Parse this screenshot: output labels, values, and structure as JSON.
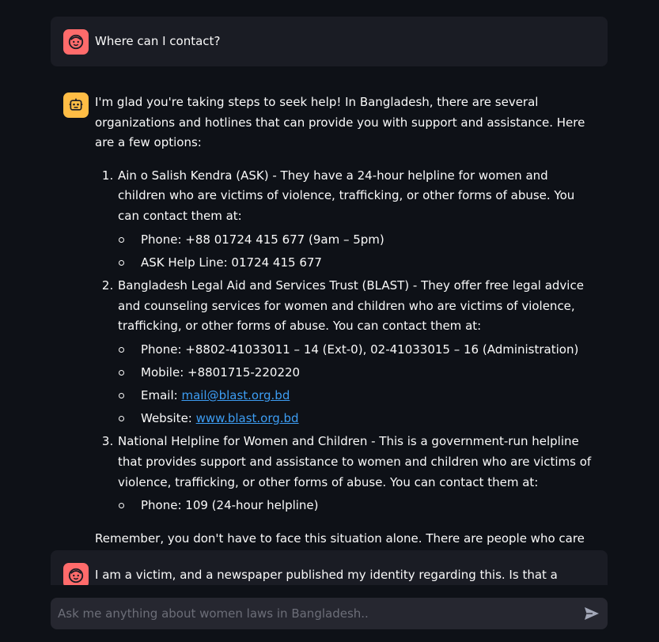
{
  "messages": [
    {
      "role": "user",
      "text": "Where can I contact?"
    },
    {
      "role": "assistant",
      "intro": "I'm glad you're taking steps to seek help! In Bangladesh, there are several organizations and hotlines that can provide you with support and assistance. Here are a few options:",
      "items": [
        {
          "text": "Ain o Salish Kendra (ASK) - They have a 24-hour helpline for women and children who are victims of violence, trafficking, or other forms of abuse. You can contact them at:",
          "contacts": [
            {
              "label": "Phone: +88 01724 415 677 (9am – 5pm)"
            },
            {
              "label": "ASK Help Line: 01724 415 677"
            }
          ]
        },
        {
          "text": "Bangladesh Legal Aid and Services Trust (BLAST) - They offer free legal advice and counseling services for women and children who are victims of violence, trafficking, or other forms of abuse. You can contact them at:",
          "contacts": [
            {
              "label": "Phone: +8802-41033011 – 14 (Ext-0), 02-41033015 – 16 (Administration)"
            },
            {
              "label": "Mobile: +8801715-220220"
            },
            {
              "label": "Email: ",
              "link": "mail@blast.org.bd"
            },
            {
              "label": "Website: ",
              "link": "www.blast.org.bd"
            }
          ]
        },
        {
          "text": "National Helpline for Women and Children - This is a government-run helpline that provides support and assistance to women and children who are victims of violence, trafficking, or other forms of abuse. You can contact them at:",
          "contacts": [
            {
              "label": "Phone: 109 (24-hour helpline)"
            }
          ]
        }
      ],
      "closing": "Remember, you don't have to face this situation alone. There are people who care about you and want to help. Don't hesitate to reach out for support."
    },
    {
      "role": "user",
      "text": "I am a victim, and a newspaper published my identity regarding this. Is that a crime by the"
    }
  ],
  "chat_input": {
    "placeholder": "Ask me anything about women laws in Bangladesh.."
  },
  "icons": {
    "user_avatar": "user-face-icon",
    "assistant_avatar": "robot-icon",
    "send": "send-icon"
  },
  "colors": {
    "background": "#0e1117",
    "user_message_bg": "#1a1c24",
    "user_avatar": "#ff6b6b",
    "assistant_avatar": "#ffbd45",
    "input_bg": "#262730",
    "link": "#3d9df3"
  }
}
